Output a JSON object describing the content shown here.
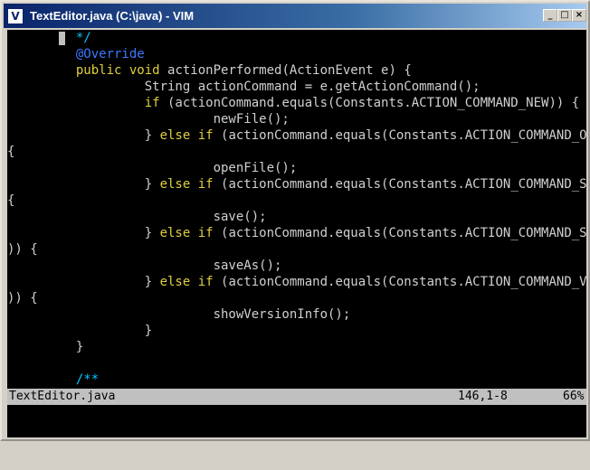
{
  "window": {
    "title": "TextEditor.java (C:\\java) - VIM",
    "app_icon_glyph": "V",
    "buttons": {
      "minimize": "_",
      "maximize": "□",
      "close": "×"
    }
  },
  "editor": {
    "lines": [
      [
        {
          "t": "         ",
          "c": "text"
        },
        {
          "t": "*/",
          "c": "comment"
        }
      ],
      [
        {
          "t": "         ",
          "c": "text"
        },
        {
          "t": "@Override",
          "c": "anno"
        }
      ],
      [
        {
          "t": "         ",
          "c": "text"
        },
        {
          "t": "public",
          "c": "kw"
        },
        {
          "t": " ",
          "c": "text"
        },
        {
          "t": "void",
          "c": "kw"
        },
        {
          "t": " actionPerformed(ActionEvent e) {",
          "c": "text"
        }
      ],
      [
        {
          "t": "                  String actionCommand = e.getActionCommand();",
          "c": "text"
        }
      ],
      [
        {
          "t": "                  ",
          "c": "text"
        },
        {
          "t": "if",
          "c": "kw"
        },
        {
          "t": " (actionCommand.equals(Constants.ACTION_COMMAND_NEW)) {",
          "c": "text"
        }
      ],
      [
        {
          "t": "                           newFile();",
          "c": "text"
        }
      ],
      [
        {
          "t": "                  } ",
          "c": "text"
        },
        {
          "t": "else",
          "c": "kw"
        },
        {
          "t": " ",
          "c": "text"
        },
        {
          "t": "if",
          "c": "kw"
        },
        {
          "t": " (actionCommand.equals(Constants.ACTION_COMMAND_OPEN))",
          "c": "text"
        }
      ],
      [
        {
          "t": "{",
          "c": "text"
        }
      ],
      [
        {
          "t": "                           openFile();",
          "c": "text"
        }
      ],
      [
        {
          "t": "                  } ",
          "c": "text"
        },
        {
          "t": "else",
          "c": "kw"
        },
        {
          "t": " ",
          "c": "text"
        },
        {
          "t": "if",
          "c": "kw"
        },
        {
          "t": " (actionCommand.equals(Constants.ACTION_COMMAND_SAVE))",
          "c": "text"
        }
      ],
      [
        {
          "t": "{",
          "c": "text"
        }
      ],
      [
        {
          "t": "                           save();",
          "c": "text"
        }
      ],
      [
        {
          "t": "                  } ",
          "c": "text"
        },
        {
          "t": "else",
          "c": "kw"
        },
        {
          "t": " ",
          "c": "text"
        },
        {
          "t": "if",
          "c": "kw"
        },
        {
          "t": " (actionCommand.equals(Constants.ACTION_COMMAND_SAVE_AS",
          "c": "text"
        }
      ],
      [
        {
          "t": ")) {",
          "c": "text"
        }
      ],
      [
        {
          "t": "                           saveAs();",
          "c": "text"
        }
      ],
      [
        {
          "t": "                  } ",
          "c": "text"
        },
        {
          "t": "else",
          "c": "kw"
        },
        {
          "t": " ",
          "c": "text"
        },
        {
          "t": "if",
          "c": "kw"
        },
        {
          "t": " (actionCommand.equals(Constants.ACTION_COMMAND_VERSION",
          "c": "text"
        }
      ],
      [
        {
          "t": ")) {",
          "c": "text"
        }
      ],
      [
        {
          "t": "                           showVersionInfo();",
          "c": "text"
        }
      ],
      [
        {
          "t": "                  }",
          "c": "text"
        }
      ],
      [
        {
          "t": "         }",
          "c": "text"
        }
      ],
      [
        {
          "t": "",
          "c": "text"
        }
      ],
      [
        {
          "t": "         ",
          "c": "text"
        },
        {
          "t": "/**",
          "c": "comment"
        }
      ]
    ]
  },
  "statusbar": {
    "filename": "TextEditor.java",
    "position": "146,1-8",
    "percent": "66%"
  },
  "colors": {
    "background": "#000000",
    "text": "#d0d0d0",
    "comment": "#00c8ff",
    "annotation": "#3c78ff",
    "keyword": "#e0d040",
    "statusbar": "#c0c0c0"
  }
}
